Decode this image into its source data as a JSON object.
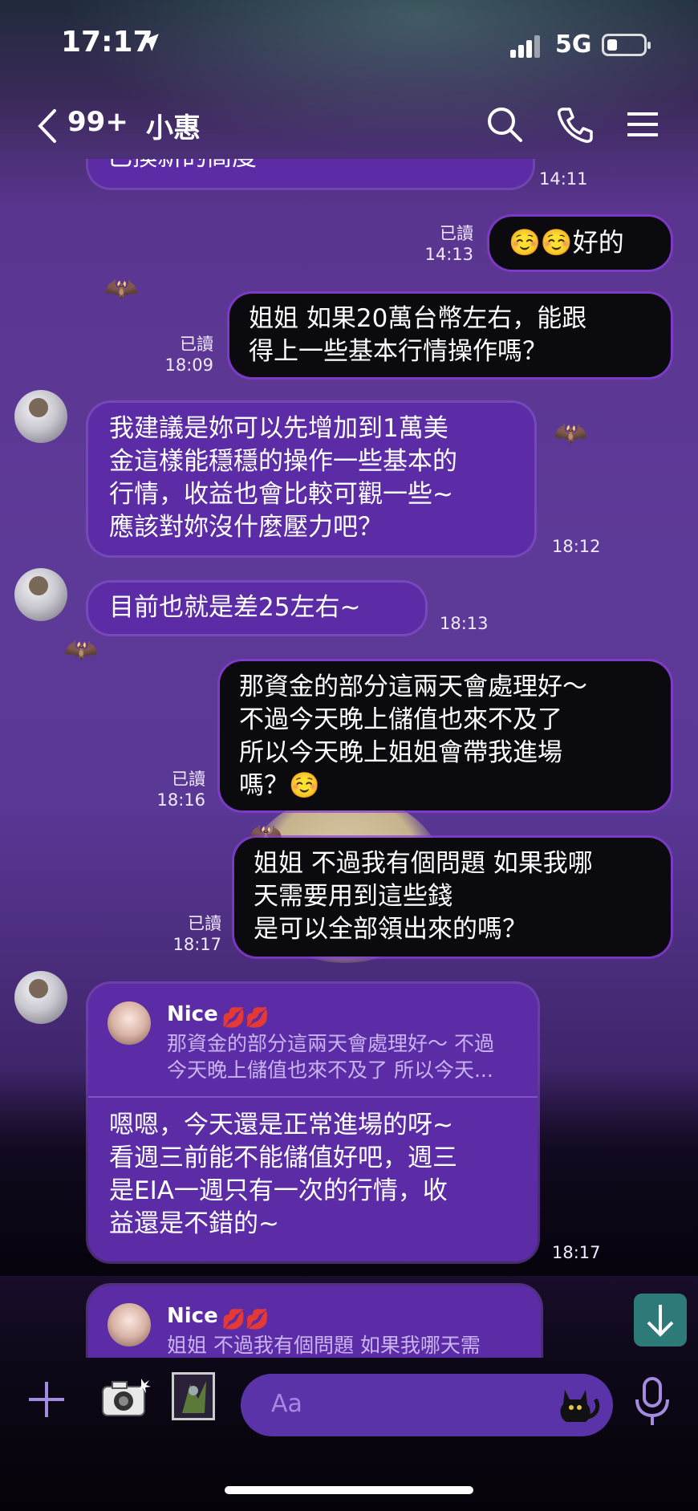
{
  "status_bar": {
    "time": "17:17",
    "network": "5G",
    "icons": [
      "location-arrow-icon",
      "signal-icon",
      "battery-icon"
    ]
  },
  "header": {
    "unread_count": "99+",
    "contact_name": "小惠",
    "icons": [
      "back-chevron-icon",
      "search-icon",
      "phone-icon",
      "menu-icon"
    ]
  },
  "messages": [
    {
      "side": "in",
      "text": "已換新的高度",
      "time": "14:11",
      "partial": true
    },
    {
      "side": "out",
      "text": "☺️☺️好的",
      "read": "已讀",
      "time": "14:13"
    },
    {
      "side": "out",
      "text": "姐姐 如果20萬台幣左右，能跟\n得上一些基本行情操作嗎？",
      "read": "已讀",
      "time": "18:09"
    },
    {
      "side": "in",
      "text": "我建議是妳可以先增加到1萬美\n金這樣能穩穩的操作一些基本的\n行情，收益也會比較可觀一些~\n應該對妳沒什麼壓力吧？",
      "time": "18:12"
    },
    {
      "side": "in",
      "text": "目前也就是差25左右~",
      "time": "18:13"
    },
    {
      "side": "out",
      "text": "那資金的部分這兩天會處理好～\n不過今天晚上儲值也來不及了\n所以今天晚上姐姐會帶我進場\n嗎？☺️",
      "read": "已讀",
      "time": "18:16"
    },
    {
      "side": "out",
      "text": "姐姐 不過我有個問題 如果我哪\n天需要用到這些錢\n是可以全部領出來的嗎？",
      "read": "已讀",
      "time": "18:17"
    },
    {
      "side": "in",
      "reply_to": {
        "name": "Nice",
        "emoji": "💋💋",
        "quote": "那資金的部分這兩天會處理好～ 不過\n今天晚上儲值也來不及了 所以今天..."
      },
      "text": "嗯嗯，今天還是正常進場的呀~\n看週三前能不能儲值好吧，週三\n是EIA一週只有一次的行情，收\n益還是不錯的~",
      "time": "18:17"
    },
    {
      "side": "in",
      "reply_to": {
        "name": "Nice",
        "emoji": "💋💋",
        "quote": "姐姐 不過我有個問題 如果我哪天需"
      },
      "partial": true
    }
  ],
  "input_bar": {
    "placeholder": "Aa",
    "icons": [
      "plus-icon",
      "camera-icon",
      "gallery-icon",
      "cat-sticker-icon",
      "microphone-icon"
    ]
  },
  "scroll_down_icon": "arrow-down-icon"
}
